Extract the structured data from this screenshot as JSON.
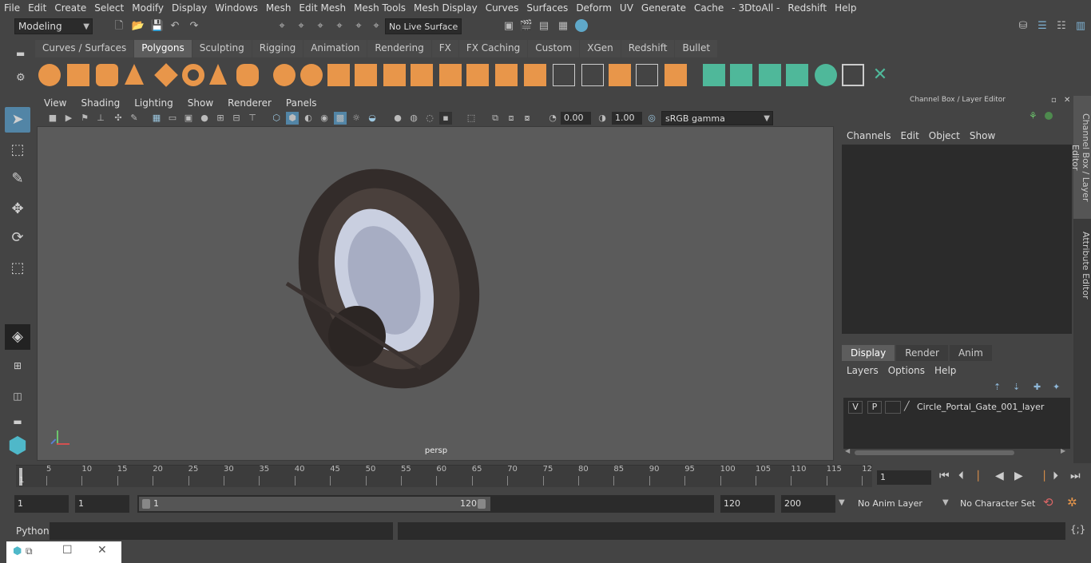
{
  "menubar": {
    "items": [
      "File",
      "Edit",
      "Create",
      "Select",
      "Modify",
      "Display",
      "Windows",
      "Mesh",
      "Edit Mesh",
      "Mesh Tools",
      "Mesh Display",
      "Curves",
      "Surfaces",
      "Deform",
      "UV",
      "Generate",
      "Cache",
      "- 3DtoAll -",
      "Redshift",
      "Help"
    ]
  },
  "statusline": {
    "mode": "Modeling",
    "live_surface": "No Live Surface"
  },
  "shelf": {
    "tabs": [
      "Curves / Surfaces",
      "Polygons",
      "Sculpting",
      "Rigging",
      "Animation",
      "Rendering",
      "FX",
      "FX Caching",
      "Custom",
      "XGen",
      "Redshift",
      "Bullet"
    ],
    "active_tab": "Polygons"
  },
  "viewport": {
    "menus": [
      "View",
      "Shading",
      "Lighting",
      "Show",
      "Renderer",
      "Panels"
    ],
    "exposure": "0.00",
    "gamma": "1.00",
    "color_space": "sRGB gamma",
    "camera_label": "persp"
  },
  "channelbox": {
    "title": "Channel Box / Layer Editor",
    "menus": [
      "Channels",
      "Edit",
      "Object",
      "Show"
    ]
  },
  "layers": {
    "tabs": [
      "Display",
      "Render",
      "Anim"
    ],
    "active_tab": "Display",
    "menus": [
      "Layers",
      "Options",
      "Help"
    ],
    "rows": [
      {
        "v": "V",
        "p": "P",
        "name": "Circle_Portal_Gate_001_layer"
      }
    ]
  },
  "side_tabs": [
    "Channel Box / Layer Editor",
    "Attribute Editor"
  ],
  "timeline": {
    "ticks": [
      "5",
      "10",
      "15",
      "20",
      "25",
      "30",
      "35",
      "40",
      "45",
      "50",
      "55",
      "60",
      "65",
      "70",
      "75",
      "80",
      "85",
      "90",
      "95",
      "100",
      "105",
      "110",
      "115",
      "12"
    ],
    "start_label": "1",
    "current_frame": "1"
  },
  "range": {
    "start": "1",
    "playback_start": "1",
    "slider_start": "1",
    "slider_end": "120",
    "playback_end": "120",
    "end": "200",
    "anim_layer": "No Anim Layer",
    "character_set": "No Character Set"
  },
  "cmdline": {
    "label": "Python"
  },
  "colors": {
    "accent_blue": "#5285a6",
    "shelf_orange": "#e8964a",
    "shelf_green": "#4fb89a"
  }
}
